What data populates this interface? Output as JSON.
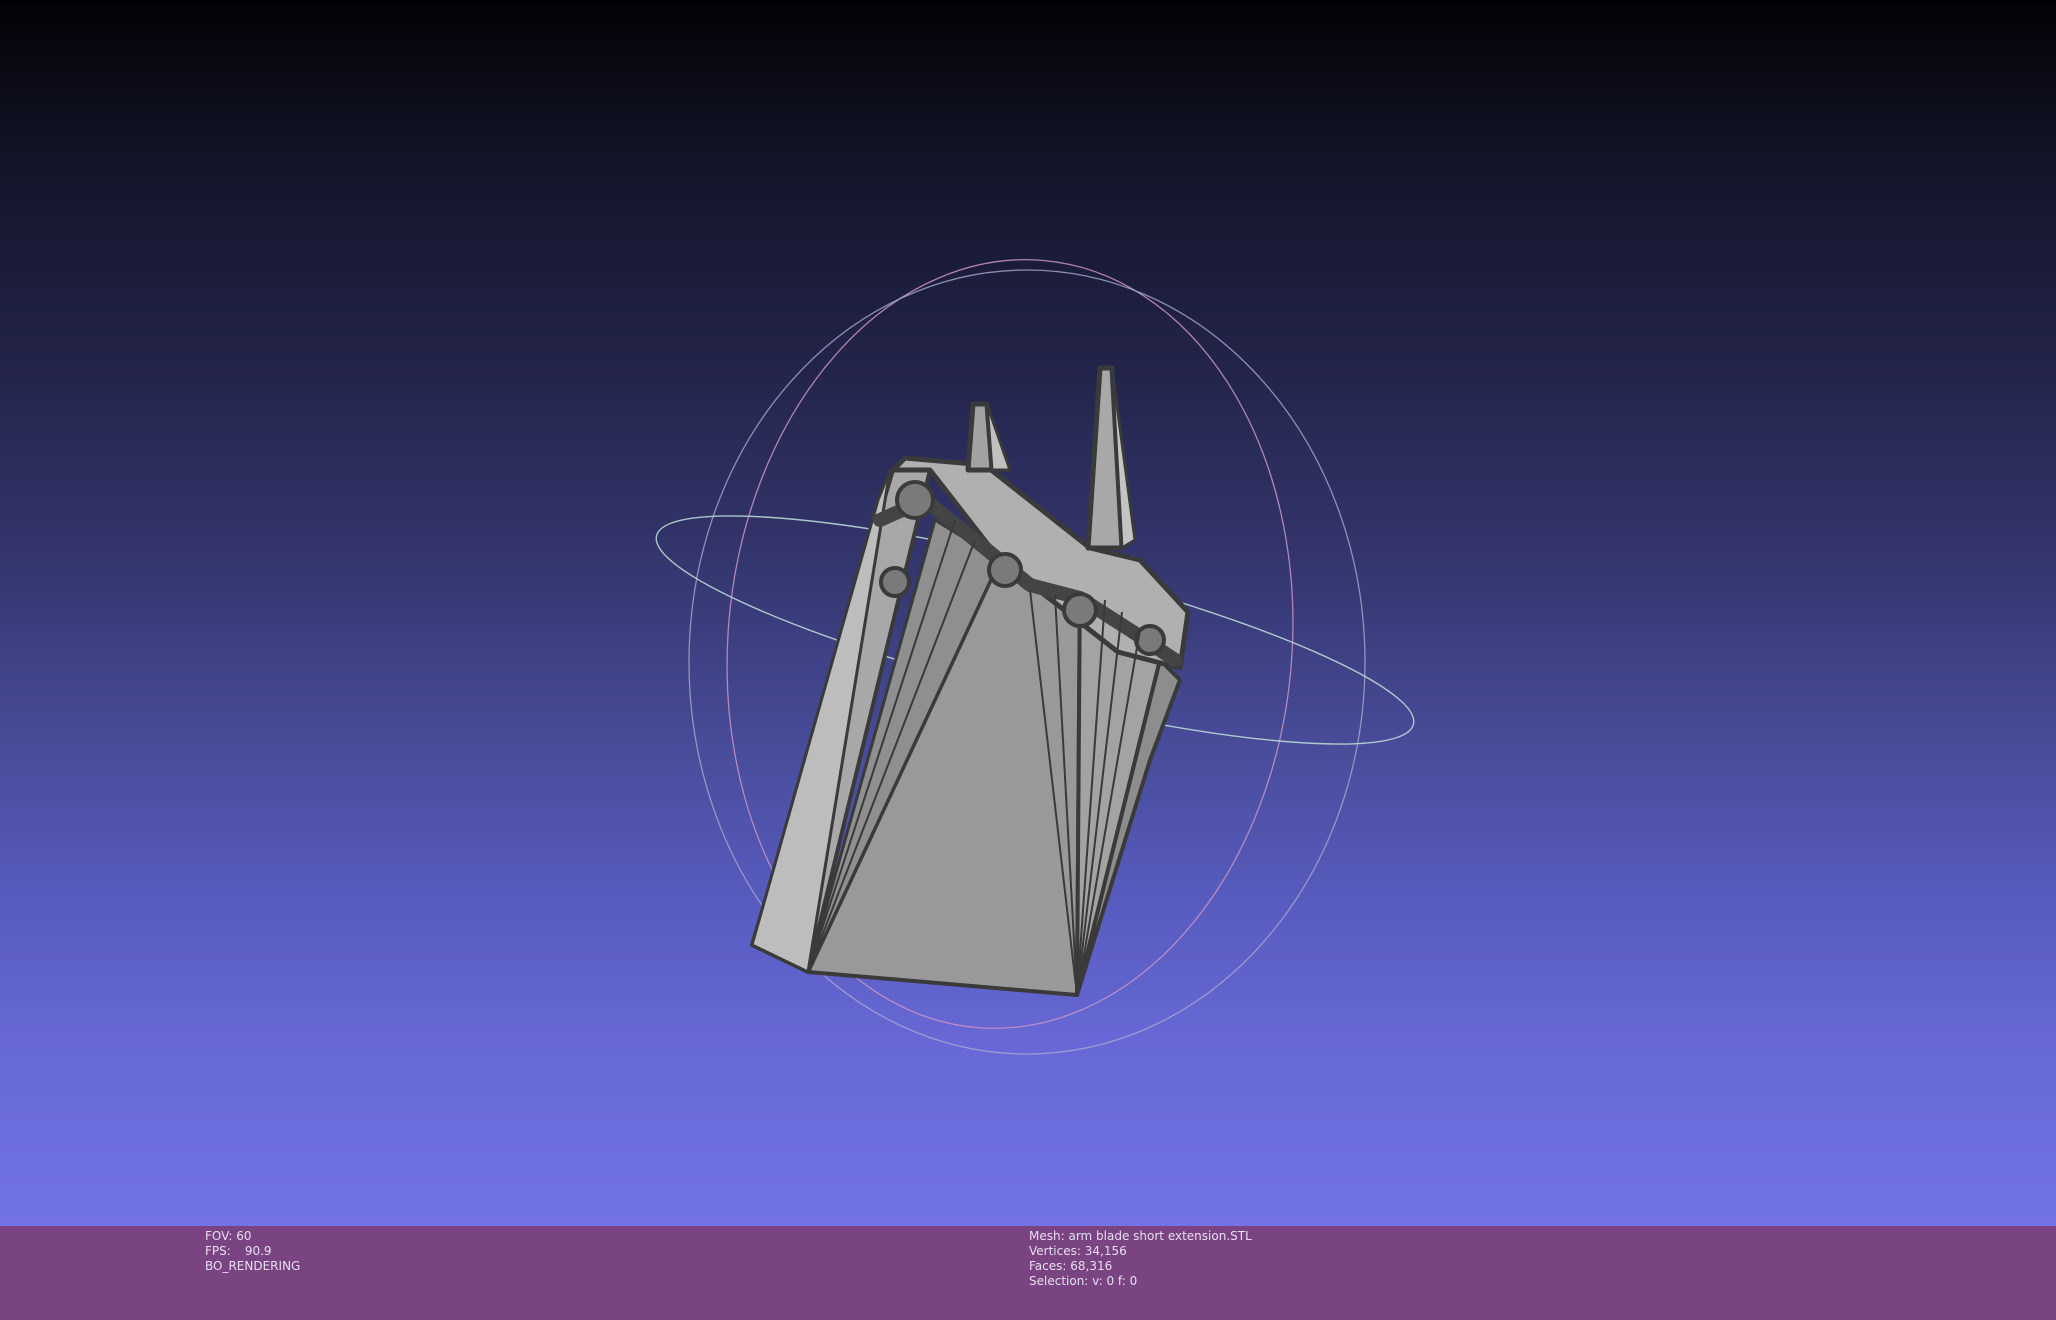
{
  "viewer": {
    "background_top": "#020206",
    "background_bottom": "#7273e6",
    "status_bar_color": "#7a4482",
    "mesh_color": "#9a9a9a",
    "edge_color": "#3c3c3c"
  },
  "render_info": {
    "fov_label": "FOV:",
    "fov_value": "60",
    "fps_label": "FPS:",
    "fps_value": "90.9",
    "mode": "BO_RENDERING"
  },
  "mesh_info": {
    "mesh_label": "Mesh:",
    "mesh_name": "arm blade short extension.STL",
    "vertices_label": "Vertices:",
    "vertices": "34,156",
    "faces_label": "Faces:",
    "faces": "68,316",
    "selection_label": "Selection:",
    "selection": "v: 0 f: 0"
  },
  "trackball": {
    "rings": [
      "red-ring",
      "green-ring",
      "blue-ring"
    ]
  }
}
